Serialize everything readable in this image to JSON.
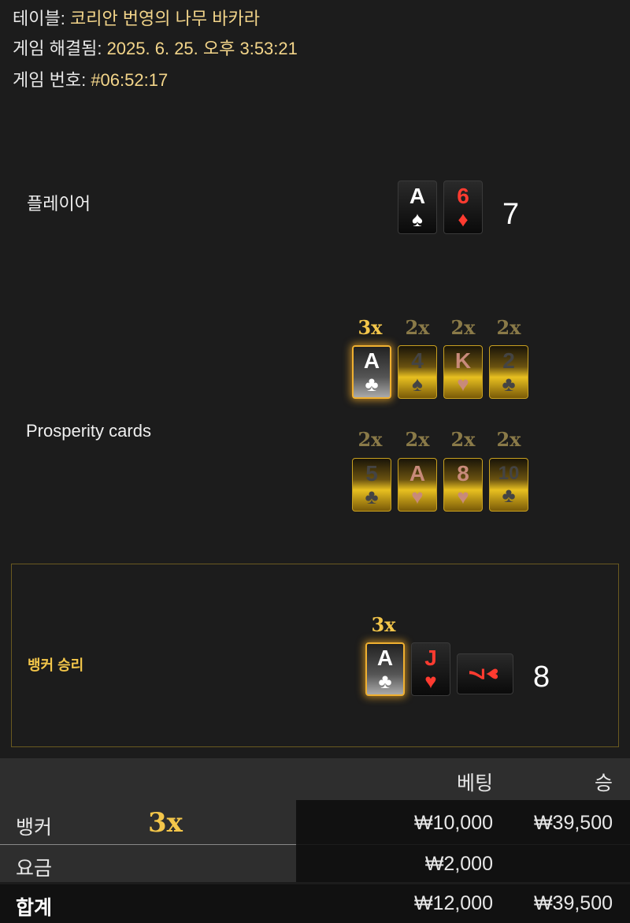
{
  "info": {
    "table_label": "테이블:",
    "table_value": "코리안 번영의 나무 바카라",
    "resolved_label": "게임 해결됨:",
    "resolved_value": "2025. 6. 25. 오후 3:53:21",
    "game_no_label": "게임 번호:",
    "game_no_value": "#06:52:17"
  },
  "player": {
    "label": "플레이어",
    "score": "7",
    "cards": [
      {
        "rank": "A",
        "suit": "♠",
        "color": "black"
      },
      {
        "rank": "6",
        "suit": "♦",
        "color": "red"
      }
    ]
  },
  "prosperity": {
    "label": "Prosperity cards",
    "row1": [
      {
        "mult": "3x",
        "rank": "A",
        "suit": "♣",
        "color": "black",
        "active": true
      },
      {
        "mult": "2x",
        "rank": "4",
        "suit": "♠",
        "color": "black",
        "active": false
      },
      {
        "mult": "2x",
        "rank": "K",
        "suit": "♥",
        "color": "red",
        "active": false
      },
      {
        "mult": "2x",
        "rank": "2",
        "suit": "♣",
        "color": "black",
        "active": false
      }
    ],
    "row2": [
      {
        "mult": "2x",
        "rank": "5",
        "suit": "♣",
        "color": "black",
        "active": false
      },
      {
        "mult": "2x",
        "rank": "A",
        "suit": "♥",
        "color": "red",
        "active": false
      },
      {
        "mult": "2x",
        "rank": "8",
        "suit": "♥",
        "color": "red",
        "active": false
      },
      {
        "mult": "2x",
        "rank": "10",
        "suit": "♣",
        "color": "black",
        "active": false
      }
    ]
  },
  "banker": {
    "label": "뱅커 승리",
    "score": "8",
    "mult": "3x",
    "cards": [
      {
        "rank": "A",
        "suit": "♣",
        "color": "black",
        "lucky": true
      },
      {
        "rank": "J",
        "suit": "♥",
        "color": "red"
      },
      {
        "rank": "7",
        "suit": "♥",
        "color": "red",
        "rotated": true
      }
    ]
  },
  "bets": {
    "header_bet": "베팅",
    "header_win": "승",
    "rows": [
      {
        "name": "뱅커",
        "mult": "3x",
        "bet": "₩10,000",
        "win": "₩39,500"
      },
      {
        "name": "요금",
        "bet": "₩2,000",
        "win": ""
      },
      {
        "name": "합계",
        "bet": "₩12,000",
        "win": "₩39,500"
      }
    ]
  },
  "colors": {
    "accent_gold": "#f3c64a",
    "card_red": "#ff3b30",
    "background": "#1c1c1c"
  }
}
